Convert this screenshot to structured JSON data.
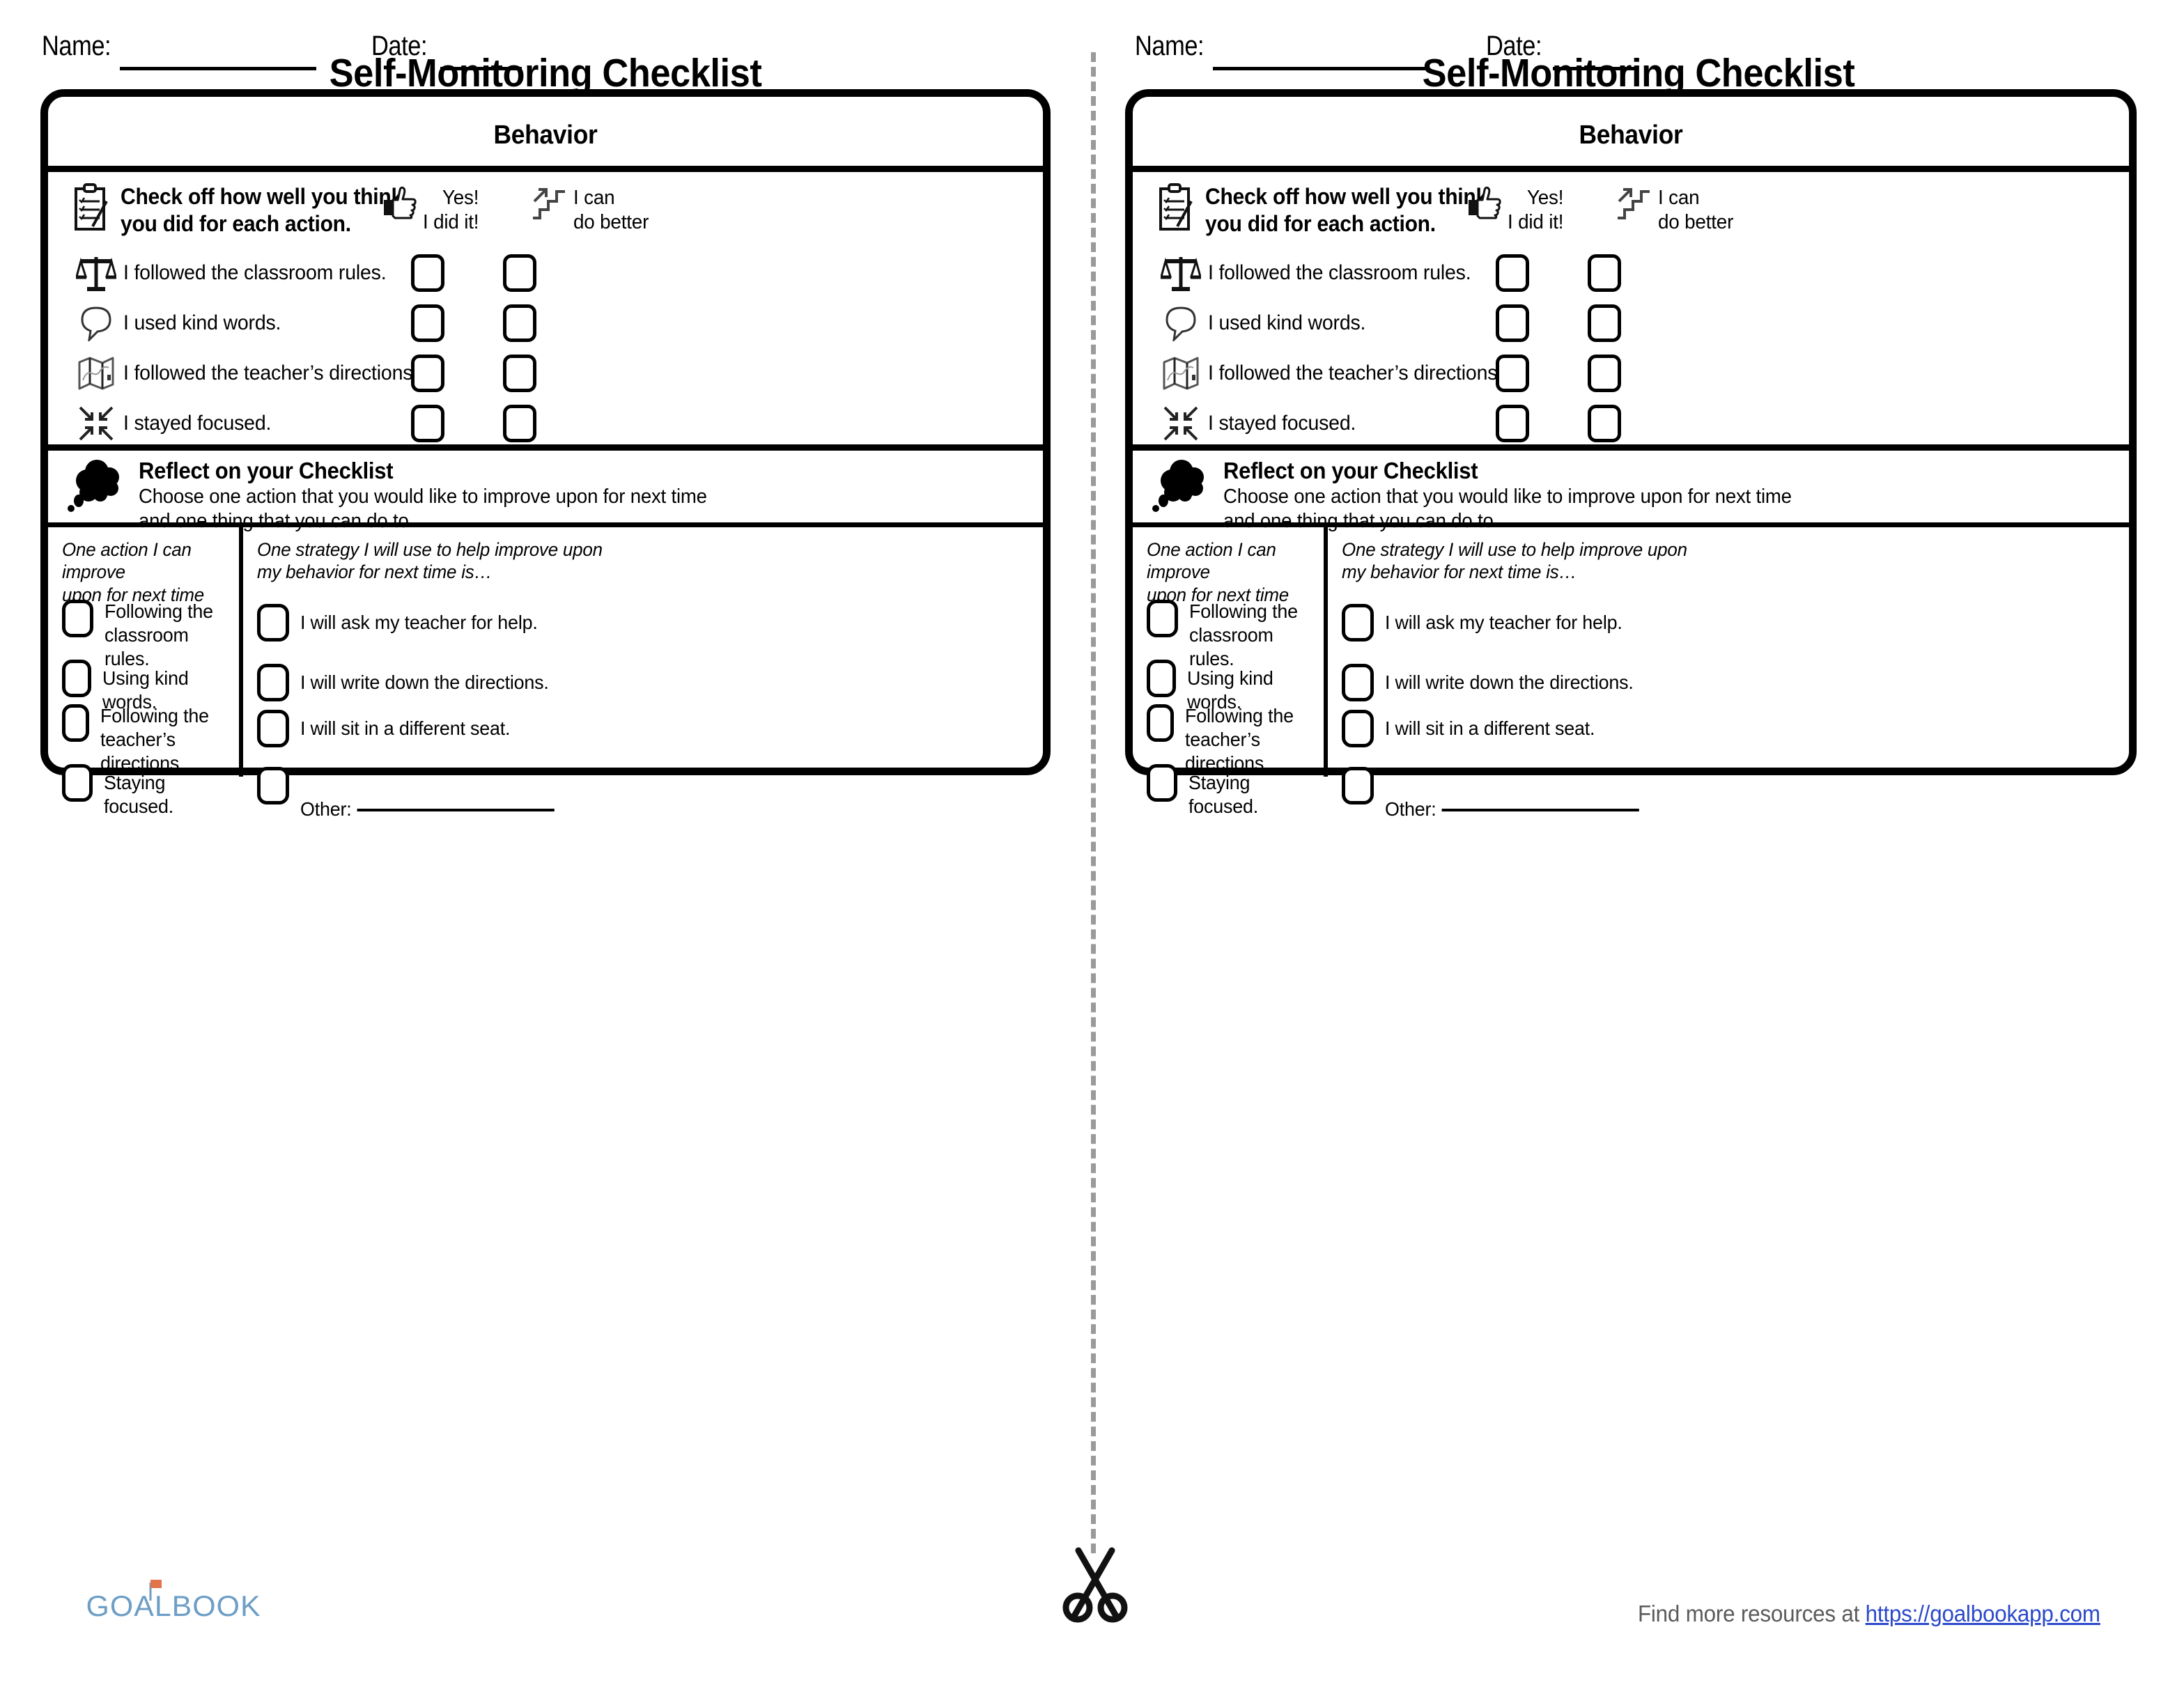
{
  "document": {
    "title": "Self-Monitoring Checklist",
    "category_title": "Behavior"
  },
  "header_fields": {
    "name_label": "Name:",
    "date_label": "Date:"
  },
  "instructions": {
    "icon": "clipboard-checklist-icon",
    "text": "Check off how well you think\nyou did for each action."
  },
  "rating_columns": [
    {
      "icon": "thumbs-up-icon",
      "label": "Yes!\nI did it!"
    },
    {
      "icon": "stairs-up-arrow-icon",
      "label": "I can\ndo better"
    }
  ],
  "behavior_items": [
    {
      "icon": "balance-scale-icon",
      "label": "I followed  the classroom rules."
    },
    {
      "icon": "speech-bubble-icon",
      "label": "I used  kind words."
    },
    {
      "icon": "folded-map-icon",
      "label": "I followed  the teacher’s directions."
    },
    {
      "icon": "focus-arrows-icon",
      "label": "I stayed focused."
    }
  ],
  "reflect": {
    "icon": "thought-bubble-icon",
    "title": "Reflect on your Checklist",
    "subtitle": "Choose one action that you would  like to improve  upon  for next time\nand one thing that you can do to"
  },
  "reflect_columns": {
    "action": {
      "heading": "One action I can improve\nupon for next time is…",
      "options": [
        "Following  the\nclassroom rules.",
        "Using kind words.",
        "Following  the\nteacher’s directions.",
        "Staying focused."
      ]
    },
    "strategy": {
      "heading": "One strategy I will  use to help improve  upon\nmy behavior for next time is…",
      "options": [
        "I will ask my teacher for help.",
        "I will write down the directions.",
        "I will sit in a different  seat.",
        "Other:"
      ],
      "other_has_blank_line": true
    }
  },
  "divider": {
    "icon": "scissors-icon",
    "style": "dashed-cut-line"
  },
  "footer": {
    "logo_text": "GOALBOOK",
    "logo_color": "#6d9ec6",
    "logo_flag_color": "#e1744a",
    "note_prefix": "Find more  resources at ",
    "link_text": "https://goalbookapp.com",
    "link_color": "#2b49c9",
    "note_color": "#5b5b5b"
  }
}
